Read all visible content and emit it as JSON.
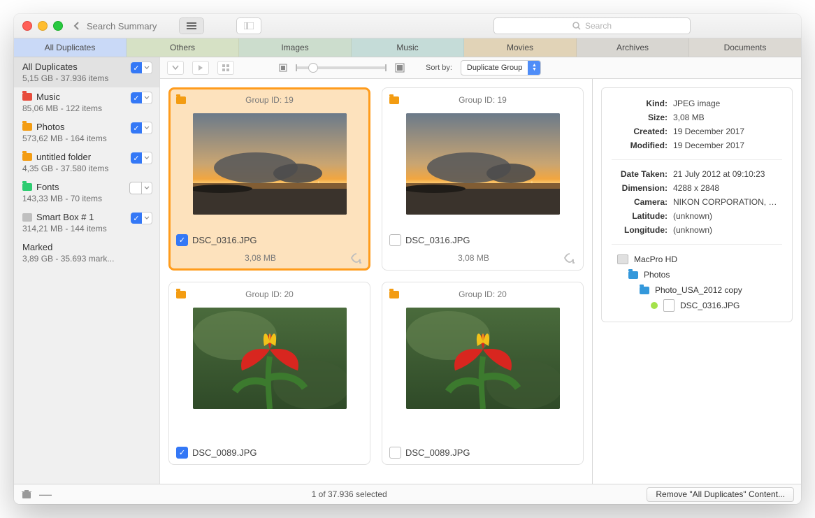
{
  "titlebar": {
    "back_label": "Search Summary",
    "search_placeholder": "Search"
  },
  "tabs": [
    {
      "label": "All Duplicates",
      "cls": "blue"
    },
    {
      "label": "Others",
      "cls": "green-a"
    },
    {
      "label": "Images",
      "cls": "green-b"
    },
    {
      "label": "Music",
      "cls": "teal"
    },
    {
      "label": "Movies",
      "cls": "tan"
    },
    {
      "label": "Archives",
      "cls": "gray"
    },
    {
      "label": "Documents",
      "cls": "gray2"
    }
  ],
  "sidebar": [
    {
      "title": "All Duplicates",
      "sub": "5,15 GB - 37.936 items",
      "checked": true,
      "selected": true,
      "icon": ""
    },
    {
      "title": "Music",
      "sub": "85,06 MB - 122 items",
      "checked": true,
      "icon": "folder-red"
    },
    {
      "title": "Photos",
      "sub": "573,62 MB - 164 items",
      "checked": true,
      "icon": "folder-orange"
    },
    {
      "title": "untitled folder",
      "sub": "4,35 GB - 37.580 items",
      "checked": true,
      "icon": "folder-orange"
    },
    {
      "title": "Fonts",
      "sub": "143,33 MB - 70 items",
      "checked": false,
      "icon": "folder-green"
    },
    {
      "title": "Smart Box # 1",
      "sub": "314,21 MB - 144 items",
      "checked": true,
      "icon": "smartbox"
    },
    {
      "title": "Marked",
      "sub": "3,89 GB - 35.693 mark...",
      "icon": "",
      "no_ctrl": true
    }
  ],
  "toolbar": {
    "sort_label": "Sort by:",
    "sort_value": "Duplicate Group"
  },
  "cards": [
    {
      "group": "Group ID: 19",
      "name": "DSC_0316.JPG",
      "size": "3,08 MB",
      "checked": true,
      "selected": true,
      "thumb": "sunset"
    },
    {
      "group": "Group ID: 19",
      "name": "DSC_0316.JPG",
      "size": "3,08 MB",
      "checked": false,
      "thumb": "sunset"
    },
    {
      "group": "Group ID: 20",
      "name": "DSC_0089.JPG",
      "size": "",
      "checked": true,
      "thumb": "flower"
    },
    {
      "group": "Group ID: 20",
      "name": "DSC_0089.JPG",
      "size": "",
      "checked": false,
      "thumb": "flower"
    }
  ],
  "info": {
    "rows1": [
      {
        "k": "Kind:",
        "v": "JPEG image"
      },
      {
        "k": "Size:",
        "v": "3,08 MB"
      },
      {
        "k": "Created:",
        "v": "19 December 2017"
      },
      {
        "k": "Modified:",
        "v": "19 December 2017"
      }
    ],
    "rows2": [
      {
        "k": "Date Taken:",
        "v": "21 July 2012 at 09:10:23"
      },
      {
        "k": "Dimension:",
        "v": "4288 x 2848"
      },
      {
        "k": "Camera:",
        "v": "NIKON CORPORATION, NI..."
      },
      {
        "k": "Latitude:",
        "v": "(unknown)"
      },
      {
        "k": "Longitude:",
        "v": "(unknown)"
      }
    ],
    "path": [
      {
        "label": "MacPro HD",
        "icon": "hdd",
        "indent": 0
      },
      {
        "label": "Photos",
        "icon": "folder-blue",
        "indent": 1
      },
      {
        "label": "Photo_USA_2012 copy",
        "icon": "folder-blue",
        "indent": 2
      },
      {
        "label": "DSC_0316.JPG",
        "icon": "file",
        "indent": 3,
        "tag": "#a4e24a"
      }
    ]
  },
  "status": {
    "text": "1 of 37.936 selected",
    "button": "Remove \"All Duplicates\" Content..."
  }
}
